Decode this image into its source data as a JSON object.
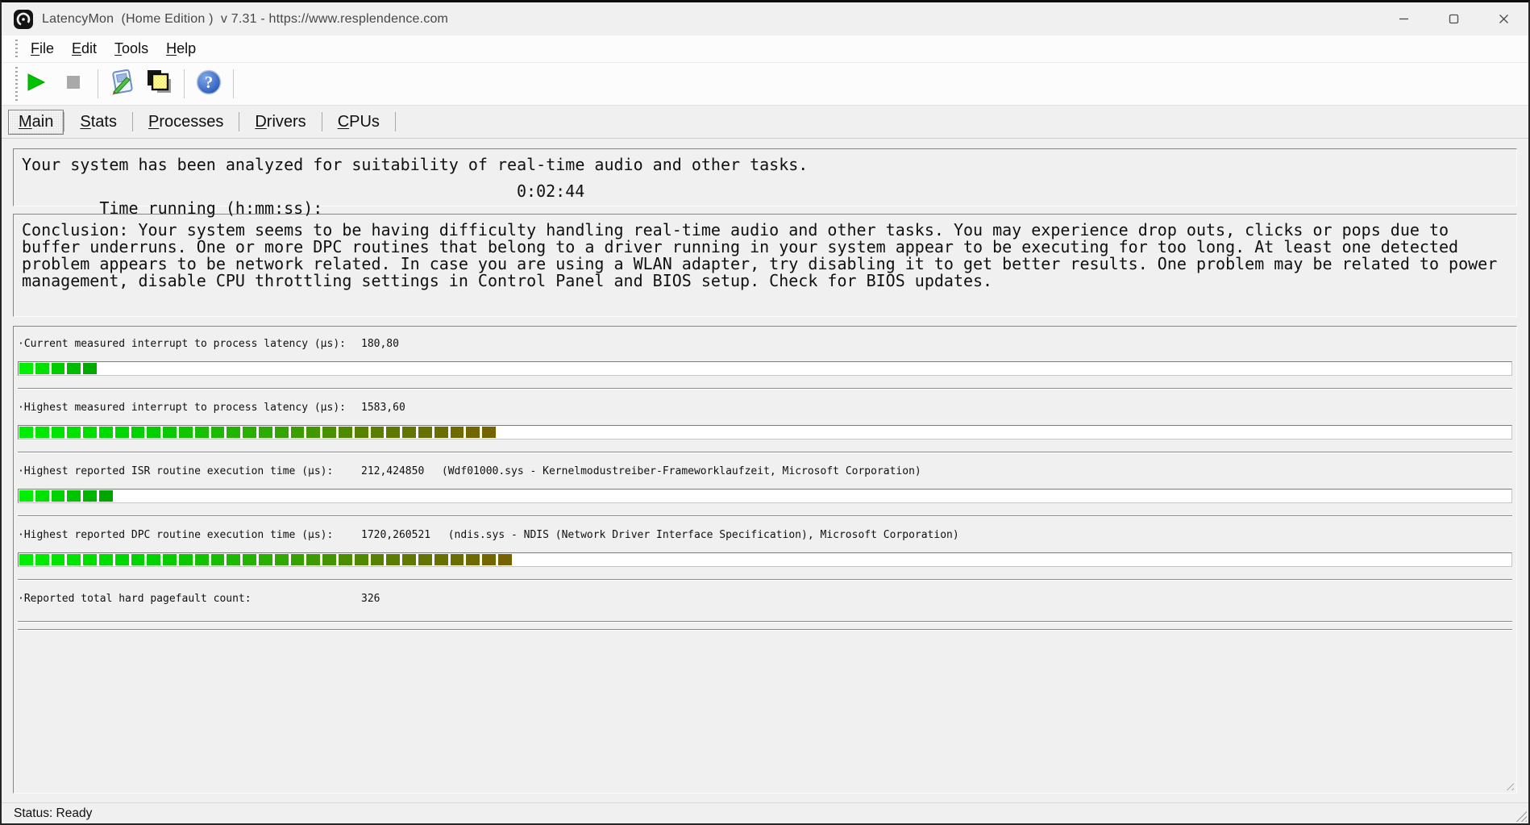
{
  "window": {
    "title": "LatencyMon  (Home Edition )  v 7.31 - https://www.resplendence.com",
    "controls": [
      {
        "name": "minimize-button"
      },
      {
        "name": "maximize-button"
      },
      {
        "name": "close-button"
      }
    ]
  },
  "menu": {
    "items": [
      "File",
      "Edit",
      "Tools",
      "Help"
    ]
  },
  "toolbar": {
    "buttons": [
      {
        "name": "start-monitor-button",
        "icon": "play-icon",
        "color": "#00c300"
      },
      {
        "name": "stop-monitor-button",
        "icon": "stop-icon",
        "color": "#a9a9a9"
      },
      {
        "name": "report-button",
        "icon": "report-pen-icon"
      },
      {
        "name": "copy-button",
        "icon": "copy-pages-icon"
      },
      {
        "name": "help-button",
        "icon": "help-icon",
        "glyph": "?"
      }
    ]
  },
  "tabs": {
    "items": [
      "Main",
      "Stats",
      "Processes",
      "Drivers",
      "CPUs"
    ],
    "active": "Main"
  },
  "summary": {
    "line1": "Your system has been analyzed for suitability of real-time audio and other tasks.",
    "time_label": "Time running (h:mm:ss):",
    "time_value": "0:02:44"
  },
  "conclusion": {
    "text": "Conclusion: Your system seems to be having difficulty handling real-time audio and other tasks. You may experience drop outs, clicks or pops due to buffer underruns. One or more DPC routines that belong to a driver running in your system appear to be executing for too long. At least one detected problem appears to be network related. In case you are using a WLAN adapter, try disabling it to get better results. One problem may be related to power management, disable CPU throttling settings in Control Panel and BIOS setup. Check for BIOS updates."
  },
  "metrics": [
    {
      "label": "·Current measured interrupt to process latency (µs):",
      "value": "180,80",
      "info": "",
      "bar": {
        "segments": 5,
        "stops": [
          "#00f000",
          "#00aa00"
        ]
      }
    },
    {
      "label": "·Highest measured interrupt to process latency (µs):",
      "value": "1583,60",
      "info": "",
      "bar": {
        "segments": 30,
        "stops": [
          "#00ec00",
          "#00d200",
          "#2aae00",
          "#5a7e00",
          "#756200"
        ]
      }
    },
    {
      "label": "·Highest reported ISR routine execution time (µs):",
      "value": "212,424850",
      "info": "(Wdf01000.sys - Kernelmodustreiber-Frameworklaufzeit, Microsoft Corporation)",
      "bar": {
        "segments": 6,
        "stops": [
          "#00f000",
          "#00a600"
        ]
      }
    },
    {
      "label": "·Highest reported DPC routine execution time (µs):",
      "value": "1720,260521",
      "info": "(ndis.sys - NDIS (Network Driver Interface Specification), Microsoft Corporation)",
      "bar": {
        "segments": 31,
        "stops": [
          "#00ec00",
          "#00d200",
          "#2aae00",
          "#5a7e00",
          "#756200"
        ]
      }
    },
    {
      "label": "·Reported total hard pagefault count:",
      "value": "326",
      "info": "",
      "bar": null
    }
  ],
  "status_bar": {
    "text": "Status: Ready"
  },
  "colors": {
    "window_bg": "#f0f0f0",
    "bar_green_start": "#00ec00",
    "bar_olive_end": "#756200",
    "play_green": "#00c300",
    "help_blue": "#2a5cc2"
  }
}
